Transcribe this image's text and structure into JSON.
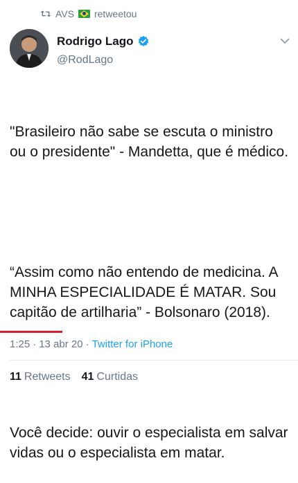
{
  "retweet_banner": {
    "user": "AVS",
    "flag_icon": "brazil-flag-icon",
    "action": "retweetou"
  },
  "author": {
    "name": "Rodrigo Lago",
    "handle": "@RodLago",
    "verified": true
  },
  "tweet": {
    "paragraph1": "\"Brasileiro não sabe se escuta o ministro ou o presidente\" - Mandetta, que é médico.",
    "paragraph2": "“Assim como não entendo de medicina. A MINHA ESPECIALIDADE É MATAR. Sou capitão de artilharia” - Bolsonaro (2018).",
    "paragraph3": "Você decide: ouvir o especialista em salvar vidas ou o especialista em matar."
  },
  "meta": {
    "time": "1:25",
    "sep1": "·",
    "date": "13 abr 20",
    "sep2": "·",
    "source": "Twitter for iPhone"
  },
  "stats": {
    "retweets_count": "11",
    "retweets_label": "Retweets",
    "likes_count": "41",
    "likes_label": "Curtidas"
  },
  "colors": {
    "accent": "#1da1f2",
    "muted": "#657786",
    "annotation_underline": "#d81e2c"
  }
}
